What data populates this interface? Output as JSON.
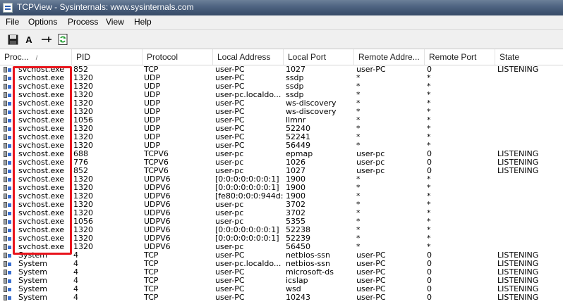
{
  "window": {
    "title": "TCPView - Sysinternals: www.sysinternals.com"
  },
  "menu": [
    "File",
    "Options",
    "Process",
    "View",
    "Help"
  ],
  "toolbar": {
    "save_icon": "floppy-disk-icon",
    "font_label": "A",
    "resolve_icon": "connector-icon",
    "refresh_icon": "refresh-icon"
  },
  "columns": [
    "Proc...",
    "PID",
    "Protocol",
    "Local Address",
    "Local Port",
    "Remote Addre...",
    "Remote Port",
    "State"
  ],
  "sort_indicator": "/",
  "rows": [
    [
      "svchost.exe",
      "852",
      "TCP",
      "user-PC",
      "1027",
      "user-PC",
      "0",
      "LISTENING"
    ],
    [
      "svchost.exe",
      "1320",
      "UDP",
      "user-PC",
      "ssdp",
      "*",
      "*",
      ""
    ],
    [
      "svchost.exe",
      "1320",
      "UDP",
      "user-PC",
      "ssdp",
      "*",
      "*",
      ""
    ],
    [
      "svchost.exe",
      "1320",
      "UDP",
      "user-pc.localdo...",
      "ssdp",
      "*",
      "*",
      ""
    ],
    [
      "svchost.exe",
      "1320",
      "UDP",
      "user-PC",
      "ws-discovery",
      "*",
      "*",
      ""
    ],
    [
      "svchost.exe",
      "1320",
      "UDP",
      "user-PC",
      "ws-discovery",
      "*",
      "*",
      ""
    ],
    [
      "svchost.exe",
      "1056",
      "UDP",
      "user-PC",
      "llmnr",
      "*",
      "*",
      ""
    ],
    [
      "svchost.exe",
      "1320",
      "UDP",
      "user-PC",
      "52240",
      "*",
      "*",
      ""
    ],
    [
      "svchost.exe",
      "1320",
      "UDP",
      "user-PC",
      "52241",
      "*",
      "*",
      ""
    ],
    [
      "svchost.exe",
      "1320",
      "UDP",
      "user-PC",
      "56449",
      "*",
      "*",
      ""
    ],
    [
      "svchost.exe",
      "688",
      "TCPV6",
      "user-pc",
      "epmap",
      "user-pc",
      "0",
      "LISTENING"
    ],
    [
      "svchost.exe",
      "776",
      "TCPV6",
      "user-pc",
      "1026",
      "user-pc",
      "0",
      "LISTENING"
    ],
    [
      "svchost.exe",
      "852",
      "TCPV6",
      "user-pc",
      "1027",
      "user-pc",
      "0",
      "LISTENING"
    ],
    [
      "svchost.exe",
      "1320",
      "UDPV6",
      "[0:0:0:0:0:0:0:1]",
      "1900",
      "*",
      "*",
      ""
    ],
    [
      "svchost.exe",
      "1320",
      "UDPV6",
      "[0:0:0:0:0:0:0:1]",
      "1900",
      "*",
      "*",
      ""
    ],
    [
      "svchost.exe",
      "1320",
      "UDPV6",
      "[fe80:0:0:0:944d:...",
      "1900",
      "*",
      "*",
      ""
    ],
    [
      "svchost.exe",
      "1320",
      "UDPV6",
      "user-pc",
      "3702",
      "*",
      "*",
      ""
    ],
    [
      "svchost.exe",
      "1320",
      "UDPV6",
      "user-pc",
      "3702",
      "*",
      "*",
      ""
    ],
    [
      "svchost.exe",
      "1056",
      "UDPV6",
      "user-pc",
      "5355",
      "*",
      "*",
      ""
    ],
    [
      "svchost.exe",
      "1320",
      "UDPV6",
      "[0:0:0:0:0:0:0:1]",
      "52238",
      "*",
      "*",
      ""
    ],
    [
      "svchost.exe",
      "1320",
      "UDPV6",
      "[0:0:0:0:0:0:0:1]",
      "52239",
      "*",
      "*",
      ""
    ],
    [
      "svchost.exe",
      "1320",
      "UDPV6",
      "user-pc",
      "56450",
      "*",
      "*",
      ""
    ],
    [
      "System",
      "4",
      "TCP",
      "user-PC",
      "netbios-ssn",
      "user-PC",
      "0",
      "LISTENING"
    ],
    [
      "System",
      "4",
      "TCP",
      "user-pc.localdo...",
      "netbios-ssn",
      "user-PC",
      "0",
      "LISTENING"
    ],
    [
      "System",
      "4",
      "TCP",
      "user-PC",
      "microsoft-ds",
      "user-PC",
      "0",
      "LISTENING"
    ],
    [
      "System",
      "4",
      "TCP",
      "user-PC",
      "icslap",
      "user-PC",
      "0",
      "LISTENING"
    ],
    [
      "System",
      "4",
      "TCP",
      "user-PC",
      "wsd",
      "user-PC",
      "0",
      "LISTENING"
    ],
    [
      "System",
      "4",
      "TCP",
      "user-PC",
      "10243",
      "user-PC",
      "0",
      "LISTENING"
    ]
  ],
  "highlight_color": "#e8141c"
}
